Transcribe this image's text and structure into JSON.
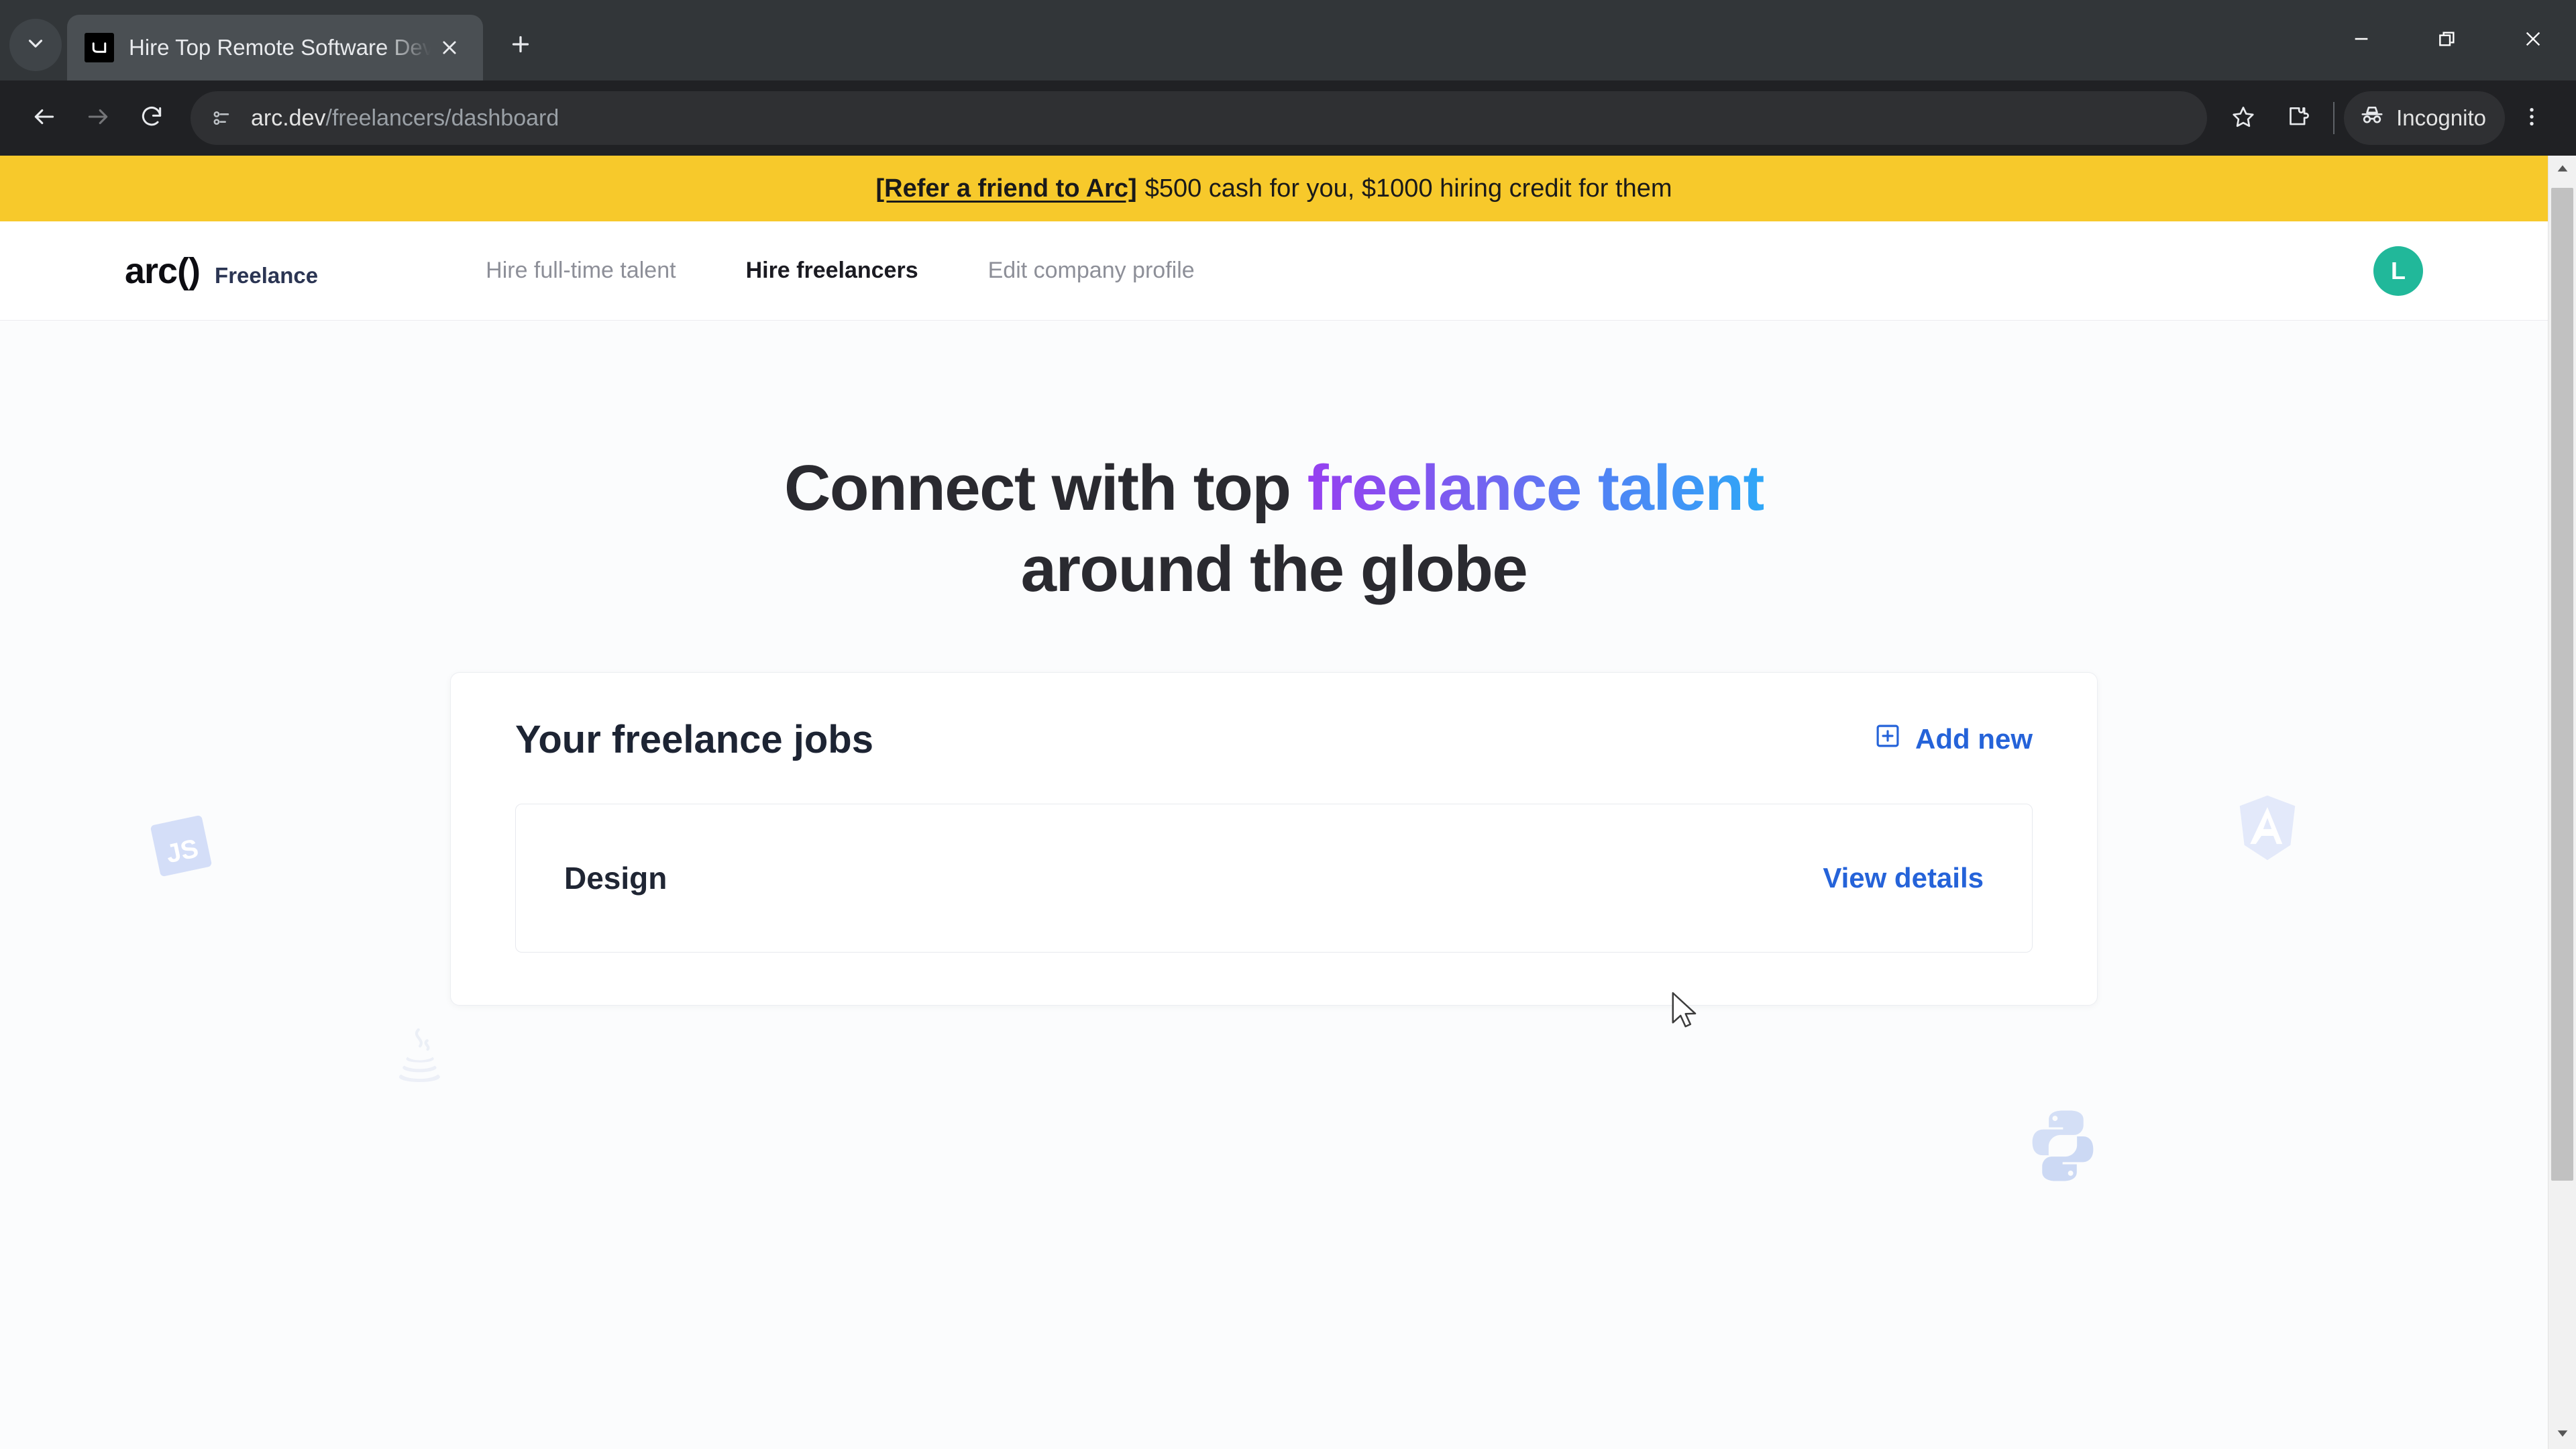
{
  "browser": {
    "tab": {
      "title": "Hire Top Remote Software Deve",
      "favicon_name": "arc-favicon",
      "close_label": "Close tab"
    },
    "tab_search_label": "Search tabs",
    "new_tab_label": "New tab",
    "window_controls": {
      "minimize": "Minimize",
      "restore": "Restore",
      "close": "Close"
    },
    "toolbar": {
      "back": "Back",
      "forward": "Forward",
      "reload": "Reload",
      "site_info": "View site information",
      "url_domain": "arc.dev",
      "url_path": "/freelancers/dashboard",
      "bookmark": "Bookmark this tab",
      "extensions": "Extensions",
      "incognito_label": "Incognito",
      "menu": "Customize and control Google Chrome"
    }
  },
  "banner": {
    "link_text": "[Refer a friend to Arc]",
    "rest_text": "$500 cash for you, $1000 hiring credit for them",
    "background": "#F7C92B"
  },
  "navbar": {
    "logo_mark": "arc()",
    "logo_sub": "Freelance",
    "links": [
      {
        "label": "Hire full-time talent",
        "active": false
      },
      {
        "label": "Hire freelancers",
        "active": true
      },
      {
        "label": "Edit company profile",
        "active": false
      }
    ],
    "avatar_initial": "L",
    "avatar_color": "#21b89a"
  },
  "hero": {
    "line1_plain": "Connect with top ",
    "line1_gradient": "freelance talent",
    "line2": "around the globe",
    "gradient_start": "#9640f0",
    "gradient_end": "#2fa7f7",
    "decorations": [
      "js-logo",
      "angular-logo",
      "java-logo",
      "python-logo"
    ]
  },
  "jobs_card": {
    "title": "Your freelance jobs",
    "add_new_label": "Add new",
    "add_new_icon": "plus-square-icon",
    "accent_color": "#2563d9",
    "rows": [
      {
        "name": "Design",
        "action_label": "View details"
      }
    ]
  },
  "scrollbar": {
    "up_label": "Scroll up",
    "down_label": "Scroll down"
  }
}
